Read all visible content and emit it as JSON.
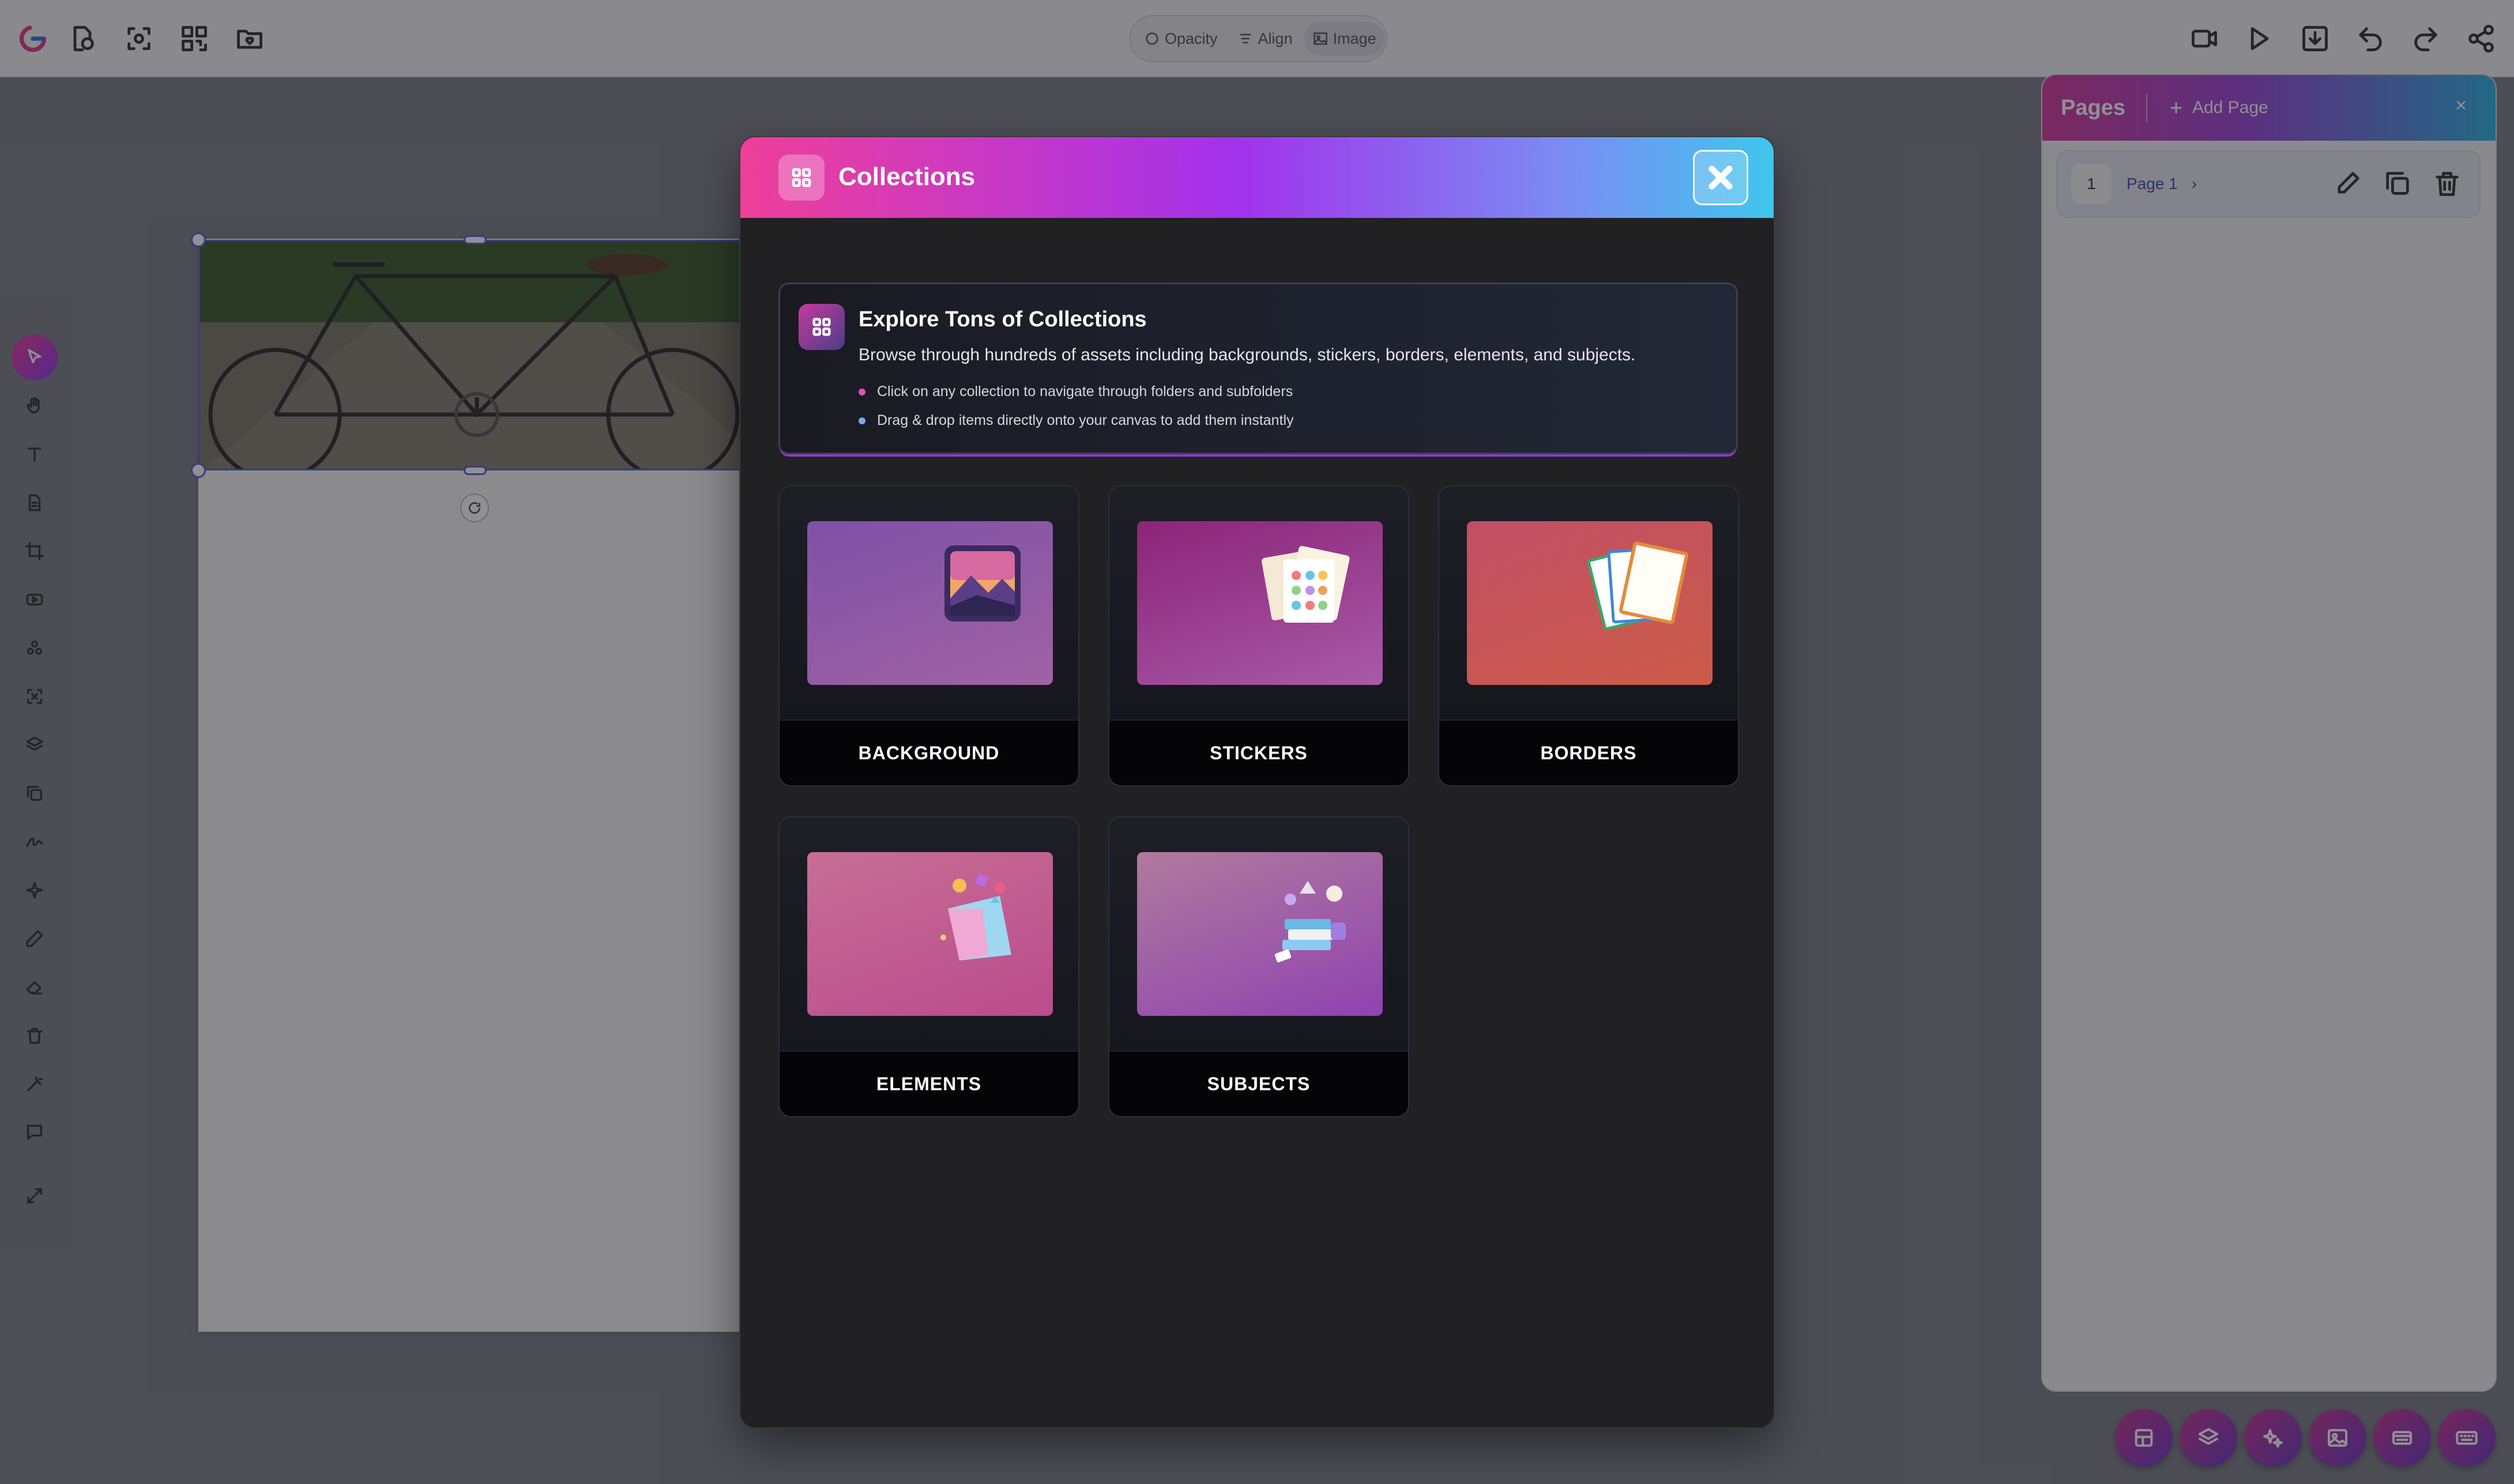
{
  "toolbar": {
    "left_icons": [
      "logo-icon",
      "new-project-icon",
      "zoom-fit-icon",
      "qr-code-icon",
      "folder-heart-icon"
    ],
    "pill": {
      "opacity_label": "Opacity",
      "align_label": "Align",
      "image_label": "Image"
    },
    "right_icons": [
      "record-video-icon",
      "play-icon",
      "download-icon",
      "undo-icon",
      "redo-icon",
      "share-icon"
    ]
  },
  "left_tools": [
    "select",
    "hand",
    "text",
    "document",
    "crop",
    "video",
    "shapes",
    "ai-detect",
    "layers",
    "duplicate",
    "signature",
    "magic",
    "pen",
    "eraser",
    "trash",
    "wand",
    "comment",
    "expand"
  ],
  "pages_panel": {
    "title": "Pages",
    "add_label": "Add Page",
    "close_glyph": "×",
    "pages": [
      {
        "number": "1",
        "name": "Page 1"
      }
    ]
  },
  "modal": {
    "title": "Collections",
    "info": {
      "title": "Explore Tons of Collections",
      "description": "Browse through hundreds of assets including backgrounds, stickers, borders, elements, and subjects.",
      "bullets": [
        "Click on any collection to navigate through folders and subfolders",
        "Drag & drop items directly onto your canvas to add them instantly"
      ]
    },
    "collections": [
      {
        "label": "BACKGROUND",
        "gradient": [
          "#7e51a6",
          "#a062a4"
        ]
      },
      {
        "label": "STICKERS",
        "gradient": [
          "#8c2478",
          "#a85aa9"
        ]
      },
      {
        "label": "BORDERS",
        "gradient": [
          "#c14f66",
          "#cc5b48"
        ]
      },
      {
        "label": "ELEMENTS",
        "gradient": [
          "#c66e95",
          "#bb4c8c"
        ]
      },
      {
        "label": "SUBJECTS",
        "gradient": [
          "#b07a9d",
          "#8f43b0"
        ]
      }
    ]
  },
  "colors": {
    "accent_pink": "#ef3f9a",
    "accent_purple": "#a232ec",
    "accent_cyan": "#3fc6ee",
    "selection": "#5b5ad8"
  }
}
